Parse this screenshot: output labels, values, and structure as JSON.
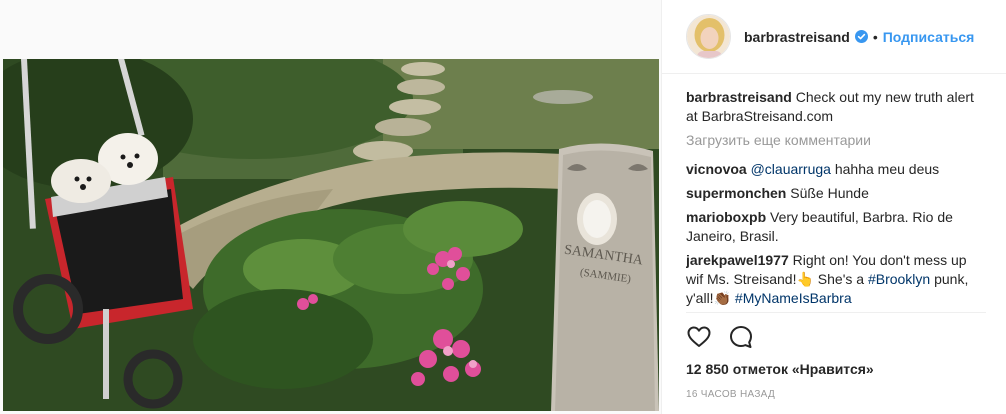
{
  "post": {
    "username": "barbrastreisand",
    "verified": true,
    "follow_label": "Подписаться",
    "separator": "•",
    "caption_user": "barbrastreisand",
    "caption_text": "Check out my new truth alert at BarbraStreisand.com",
    "load_more": "Загрузить еще комментарии",
    "likes": "12 850 отметок «Нравится»",
    "timestamp": "16 ЧАСОВ НАЗАД",
    "gravestone_name": "SAMANTHA",
    "gravestone_nick": "(SAMMIE)"
  },
  "comments": [
    {
      "user": "vicnovoa",
      "mention": "@clauarruga",
      "text": "hahha meu deus"
    },
    {
      "user": "supermonchen",
      "text": "Süße Hunde"
    },
    {
      "user": "marioboxpb",
      "text": "Very beautiful, Barbra. Rio de Janeiro, Brasil."
    },
    {
      "user": "jarekpawel1977",
      "text_a": "Right on! You don't mess up wif Ms. Streisand!👆 She's a",
      "hashtag_a": "#Brooklyn",
      "text_b": "punk, y'all!👏🏾",
      "hashtag_b": "#MyNameIsBarbra"
    }
  ],
  "icons": {
    "verified": "verified-badge-icon",
    "like": "heart-icon",
    "comment": "comment-bubble-icon"
  },
  "colors": {
    "accent": "#3897f0",
    "link": "#003569",
    "muted": "#999999"
  }
}
